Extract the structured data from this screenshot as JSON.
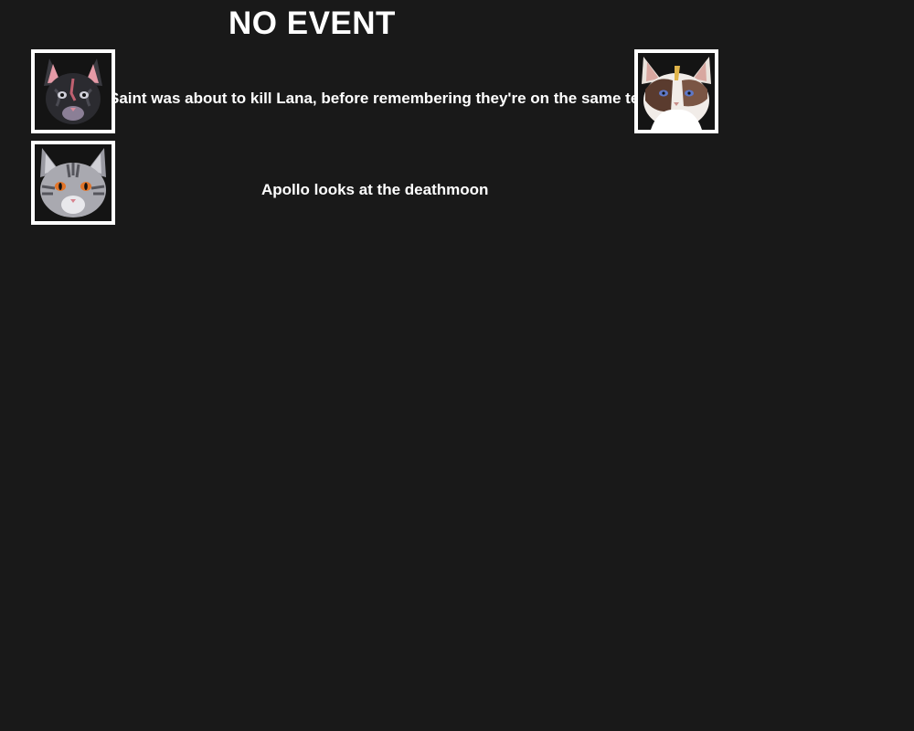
{
  "header": {
    "title": "NO EVENT"
  },
  "events": [
    {
      "text": "Saint was about to kill Lana, before remembering they're on the same team",
      "left_portrait": "dark-cat-portrait",
      "right_portrait": "brown-white-cat-portrait"
    },
    {
      "text": "Apollo looks at the deathmoon",
      "left_portrait": "grey-cat-portrait"
    }
  ],
  "colors": {
    "background": "#191919",
    "text": "#ffffff",
    "frame": "#ffffff"
  }
}
